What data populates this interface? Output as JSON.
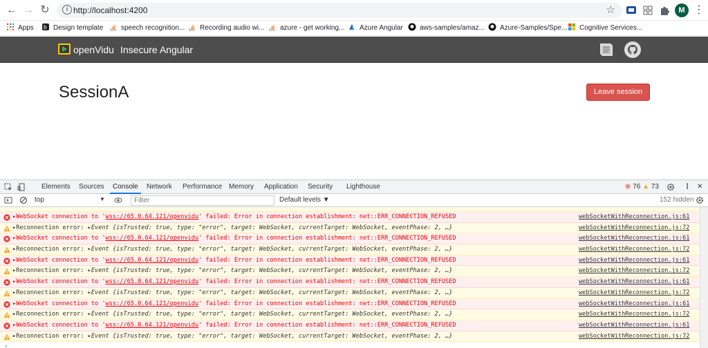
{
  "browser": {
    "url": "http://localhost:4200",
    "avatar_letter": "M",
    "bookmarks": [
      {
        "label": "Apps",
        "icon": "apps-grid-icon"
      },
      {
        "label": "Design template",
        "icon": "page-icon"
      },
      {
        "label": "speech recognition...",
        "icon": "stackoverflow-icon"
      },
      {
        "label": "Recording audio wi...",
        "icon": "stackoverflow-icon"
      },
      {
        "label": "azure - get working...",
        "icon": "stackoverflow-icon"
      },
      {
        "label": "Azure Angular",
        "icon": "azure-icon"
      },
      {
        "label": "aws-samples/amaz...",
        "icon": "github-icon"
      },
      {
        "label": "Azure-Samples/Spe...",
        "icon": "github-icon"
      },
      {
        "label": "Cognitive Services...",
        "icon": "microsoft-icon"
      }
    ]
  },
  "app": {
    "brand": "openVidu",
    "subtitle": "Insecure Angular",
    "session_name": "SessionA",
    "leave_label": "Leave session",
    "leave_color": "#d9534f",
    "header_color": "#4d4d4d"
  },
  "devtools": {
    "tabs": [
      "Elements",
      "Sources",
      "Console",
      "Network",
      "Performance",
      "Memory",
      "Application",
      "Security",
      "Lighthouse"
    ],
    "active_tab": "Console",
    "error_count": "76",
    "warning_count": "73",
    "context": "top",
    "filter_placeholder": "Filter",
    "levels_label": "Default levels ▼",
    "hidden_label": "152 hidden"
  },
  "console": {
    "error_prefix": "WebSocket connection to '",
    "error_url": "wss://65.0.64.121/openvidu",
    "error_suffix": "' failed: Error in connection establishment: net::ERR_CONNECTION_REFUSED",
    "error_source": "webSocketWithReconnection.js:61",
    "warn_label": "Reconnection error:  ",
    "warn_object": "Event {isTrusted: true, type: \"error\", target: WebSocket, currentTarget: WebSocket, eventPhase: 2, …}",
    "warn_source": "webSocketWithReconnection.js:72",
    "rows": [
      "err",
      "warn",
      "err",
      "warn",
      "err",
      "warn",
      "err",
      "warn",
      "err",
      "warn",
      "err",
      "warn"
    ]
  }
}
